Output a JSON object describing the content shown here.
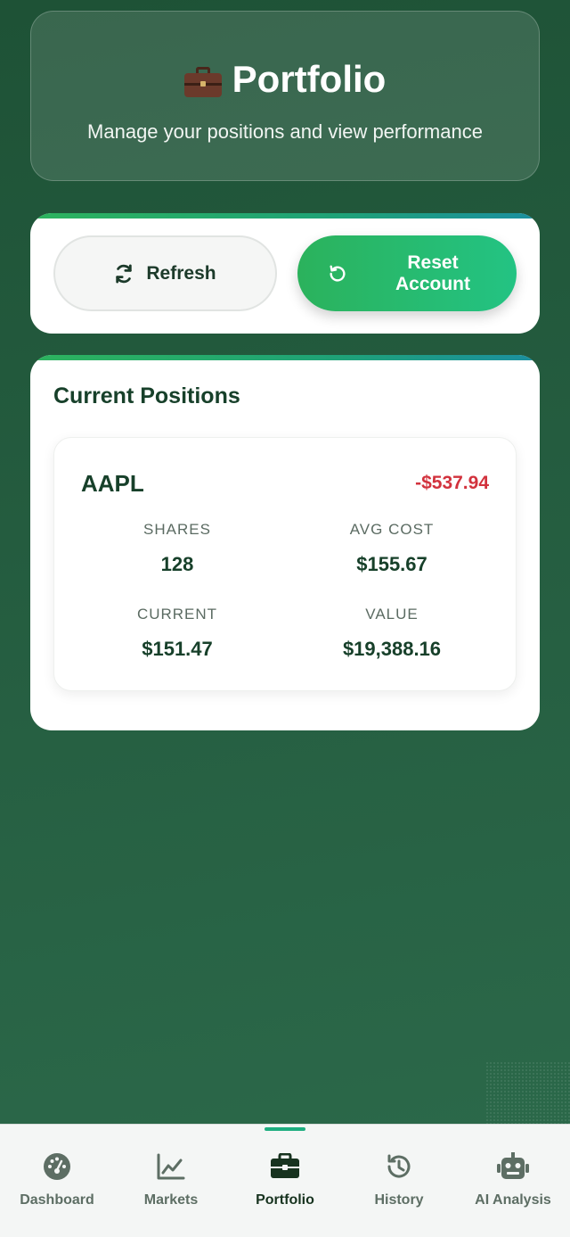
{
  "header": {
    "title": "Portfolio",
    "title_icon": "briefcase-emoji",
    "subtitle": "Manage your positions and view performance"
  },
  "actions": {
    "refresh_label": "Refresh",
    "refresh_icon": "sync-icon",
    "reset_label": "Reset Account",
    "reset_icon": "undo-icon"
  },
  "positions": {
    "title": "Current Positions",
    "items": [
      {
        "ticker": "AAPL",
        "pl": "-$537.94",
        "shares_label": "SHARES",
        "shares": "128",
        "avg_cost_label": "AVG COST",
        "avg_cost": "$155.67",
        "current_label": "CURRENT",
        "current": "$151.47",
        "value_label": "VALUE",
        "value": "$19,388.16"
      }
    ]
  },
  "nav": {
    "items": [
      {
        "label": "Dashboard",
        "icon": "gauge-icon"
      },
      {
        "label": "Markets",
        "icon": "chart-line-icon"
      },
      {
        "label": "Portfolio",
        "icon": "briefcase-icon",
        "active": true
      },
      {
        "label": "History",
        "icon": "history-icon"
      },
      {
        "label": "AI Analysis",
        "icon": "robot-icon"
      }
    ]
  },
  "colors": {
    "background": "#245c3f",
    "accent": "#2bb25c",
    "loss": "#d2323d",
    "text_dark": "#17402a"
  }
}
